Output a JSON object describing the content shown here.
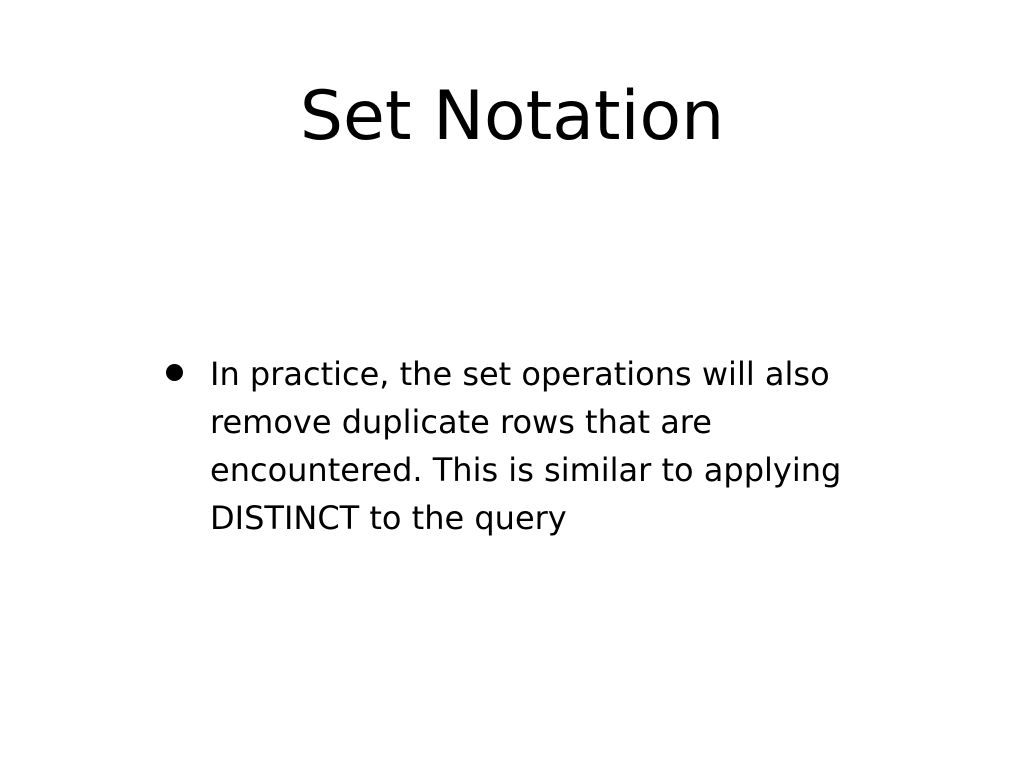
{
  "slide": {
    "title": "Set Notation",
    "bullets": [
      {
        "lines": [
          "In practice, the set operations will also",
          "remove duplicate rows that are",
          "encountered. This is similar to applying",
          "DISTINCT to the query"
        ]
      }
    ]
  },
  "colors": {
    "background": "#ffffff",
    "text": "#000000"
  }
}
